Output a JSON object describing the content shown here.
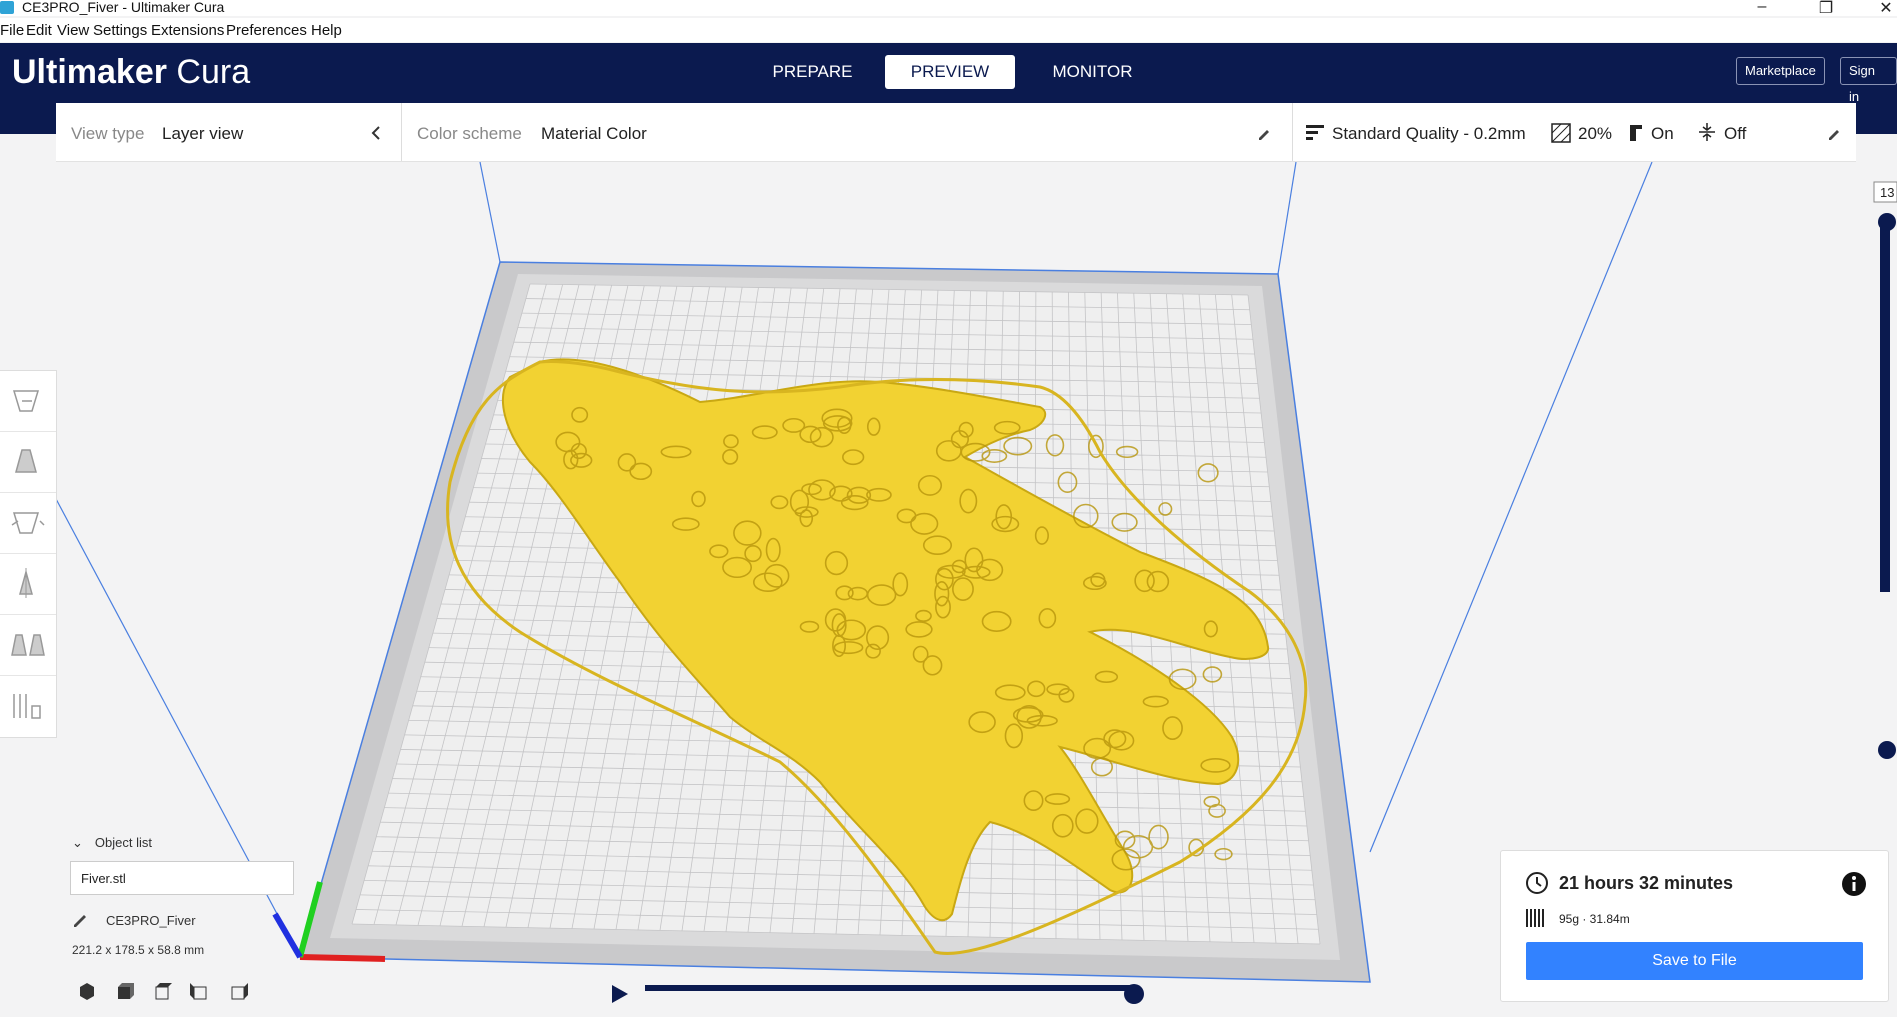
{
  "window": {
    "title": "CE3PRO_Fiver - Ultimaker Cura",
    "controls": [
      "minimize",
      "maximize",
      "close"
    ]
  },
  "menu": [
    "File",
    "Edit",
    "View",
    "Settings",
    "Extensions",
    "Preferences",
    "Help"
  ],
  "header": {
    "logo_bold": "Ultimaker",
    "logo_light": "Cura",
    "stages": [
      {
        "label": "PREPARE",
        "active": false
      },
      {
        "label": "PREVIEW",
        "active": true
      },
      {
        "label": "MONITOR",
        "active": false
      }
    ],
    "marketplace_label": "Marketplace",
    "signin_label": "Sign in"
  },
  "toolbar": {
    "view_type_label": "View type",
    "view_type_value": "Layer view",
    "color_scheme_label": "Color scheme",
    "color_scheme_value": "Material Color",
    "quality_value": "Standard Quality - 0.2mm",
    "infill_value": "20%",
    "support_value": "On",
    "adhesion_value": "Off"
  },
  "layer_view": {
    "current_layer_label": "13",
    "model_color": "#f2d232"
  },
  "object_list": {
    "header": "Object list",
    "file_name": "Fiver.stl",
    "machine_name": "CE3PRO_Fiver",
    "dimensions": "221.2 x 178.5 x 58.8 mm"
  },
  "print_info": {
    "time": "21 hours 32 minutes",
    "material": "95g · 31.84m",
    "save_label": "Save to File"
  },
  "colors": {
    "header_bg": "#0b1a4f",
    "accent_blue": "#3282ff",
    "model_yellow": "#f2d232"
  }
}
